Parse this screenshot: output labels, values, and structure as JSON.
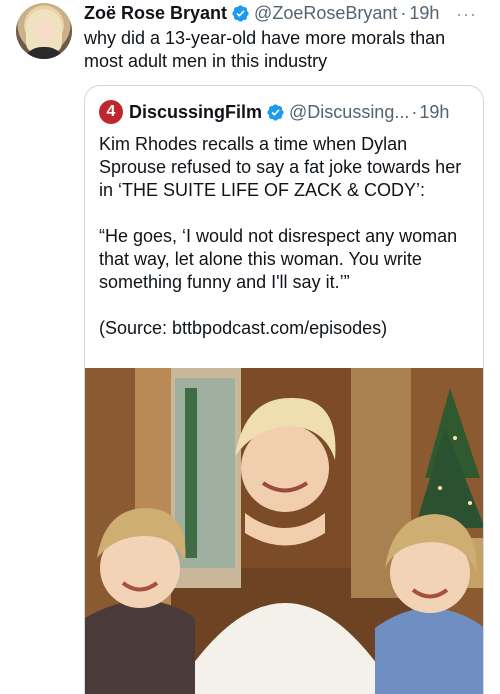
{
  "tweet": {
    "author_name": "Zoë Rose Bryant",
    "handle": "@ZoeRoseBryant",
    "separator": "·",
    "time": "19h",
    "more_label": "···",
    "text": "why did a 13-year-old have more morals than most adult men in this industry"
  },
  "quote": {
    "logo_label": "4",
    "author_name": "DiscussingFilm",
    "handle": "@Discussing...",
    "separator": "·",
    "time": "19h",
    "text": "Kim Rhodes recalls a time when Dylan Sprouse refused to say a fat joke towards her in ‘THE SUITE LIFE OF ZACK & CODY’:\n\n“He goes, ‘I would not disrespect any woman that way, let alone this woman. You write something funny and I'll say it.’”\n\n(Source: bttbpodcast.com/episodes)"
  },
  "colors": {
    "verified": "#1d9bf0",
    "secondary_text": "#536471",
    "border": "#cfd9de",
    "logo": "#c0272d"
  }
}
